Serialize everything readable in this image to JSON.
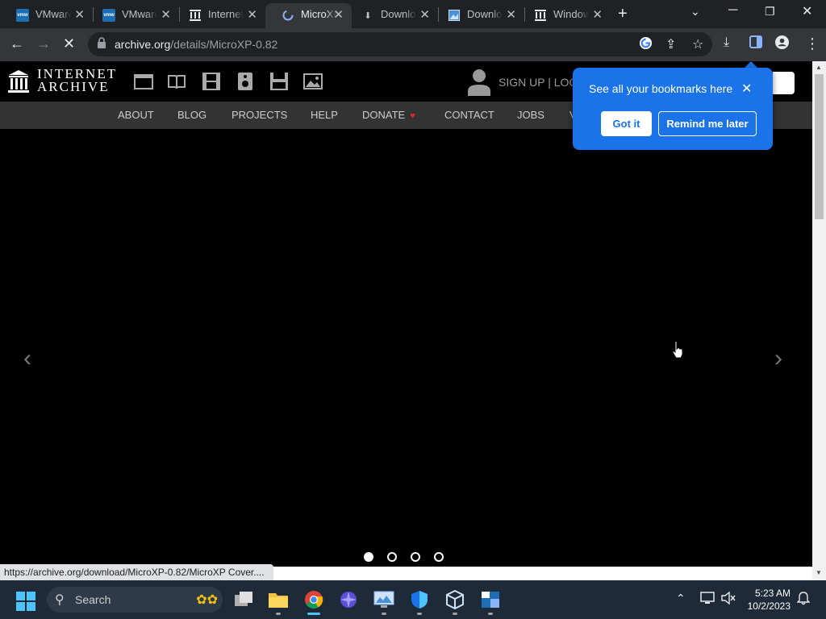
{
  "browser": {
    "tabs": [
      {
        "label": "VMware",
        "icon": "vmware-icon",
        "active": false
      },
      {
        "label": "VMware",
        "icon": "vmware-icon",
        "active": false
      },
      {
        "label": "Internet Archive",
        "icon": "archive-icon",
        "active": false
      },
      {
        "label": "MicroXP",
        "icon": "loading-icon",
        "active": true
      },
      {
        "label": "Download",
        "icon": "download-icon",
        "active": false
      },
      {
        "label": "Download",
        "icon": "image-icon",
        "active": false
      },
      {
        "label": "Windows",
        "icon": "archive-icon",
        "active": false
      }
    ],
    "url_host": "archive.org",
    "url_path": "/details/MicroXP-0.82",
    "status_url": "https://archive.org/download/MicroXP-0.82/MicroXP Cover...."
  },
  "site": {
    "logo_line1": "INTERNET",
    "logo_line2": "ARCHIVE",
    "signup": "SIGN UP | LOG",
    "nav": [
      "ABOUT",
      "BLOG",
      "PROJECTS",
      "HELP",
      "DONATE",
      "CONTACT",
      "JOBS",
      "V"
    ]
  },
  "carousel": {
    "prev": "‹",
    "next": "›",
    "slide_count": 4,
    "active_slide": 1
  },
  "bookmark_bubble": {
    "text": "See all your bookmarks here",
    "got_it": "Got it",
    "remind": "Remind me later"
  },
  "taskbar": {
    "search_label": "Search",
    "time": "5:23 AM",
    "date": "10/2/2023"
  }
}
